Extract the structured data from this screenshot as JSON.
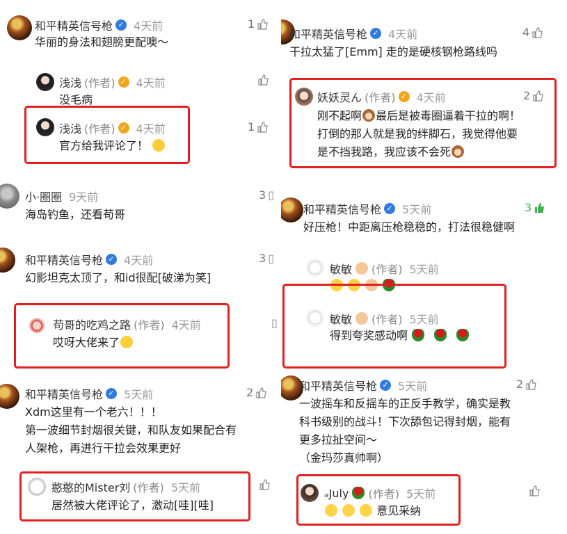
{
  "panels": {
    "p1": {
      "main": {
        "name": "和平精英信号枪",
        "time": "4天前",
        "likes": "1",
        "text": "华丽的身法和翅膀更配噢～"
      },
      "reply1": {
        "name": "浅浅",
        "author": "(作者)",
        "time": "4天前",
        "text": "没毛病"
      },
      "reply2": {
        "name": "浅浅",
        "author": "(作者)",
        "time": "4天前",
        "likes": "1",
        "text": "官方给我评论了！"
      }
    },
    "p2": {
      "main": {
        "name": "和平精英信号枪",
        "time": "4天前",
        "likes": "4",
        "text": "干拉太猛了[Emm] 走的是硬核钢枪路线吗"
      },
      "reply1": {
        "name": "妖妖灵ん",
        "author": "(作者)",
        "time": "4天前",
        "likes": "2",
        "lines": [
          "刚不起啊",
          "最后是被毒圈逼着干拉的啊！",
          "打倒的那人就是我的绊脚石，我觉得他要",
          "是不挡我路，我应该不会死"
        ]
      }
    },
    "p3": {
      "c1": {
        "name": "小·圈圈",
        "time": "9天前",
        "likes": "3",
        "text": "海岛钓鱼，还看苟哥"
      },
      "c2": {
        "name": "和平精英信号枪",
        "time": "4天前",
        "likes": "3",
        "text": "幻影坦克太顶了，和id很配[破涕为笑]"
      },
      "reply": {
        "name": "苟哥的吃鸡之路",
        "author": "(作者)",
        "time": "4天前",
        "text": "哎呀大佬来了"
      }
    },
    "p4": {
      "main": {
        "name": "和平精英信号枪",
        "time": "5天前",
        "likes": "3",
        "text": "好压枪！中距离压枪稳稳的，打法很稳健啊"
      },
      "reply1": {
        "name": "敏敏",
        "author": "(作者)",
        "time": "5天前"
      },
      "reply2": {
        "name": "敏敏",
        "author": "(作者)",
        "time": "5天前",
        "text": "得到夸奖感动啊"
      }
    },
    "p5": {
      "main": {
        "name": "和平精英信号枪",
        "time": "5天前",
        "likes": "2",
        "lines": [
          "Xdm这里有一个老六！！！",
          "第一波细节封烟很关键，和队友如果配合有",
          "人架枪，再进行干拉会效果更好"
        ]
      },
      "reply": {
        "name": "憨憨的Mister刘",
        "author": "(作者)",
        "time": "5天前",
        "text": "居然被大佬评论了，激动[哇][哇]"
      }
    },
    "p6": {
      "main": {
        "name": "和平精英信号枪",
        "time": "5天前",
        "likes": "2",
        "lines": [
          "一波摇车和反摇车的正反手教学，确实是教",
          "科书级别的战斗！下次舔包记得封烟，能有",
          "更多拉扯空间～",
          "（金玛莎真帅啊）"
        ]
      },
      "reply": {
        "name": "July",
        "prefix": "ₔ",
        "author": "(作者)",
        "time": "5天前",
        "text": "意见采纳"
      }
    }
  },
  "colors": {
    "highlight": "#e02020",
    "verified": "#2f7bde",
    "author_badge": "#f1a51c",
    "liked": "#3bb34a"
  }
}
